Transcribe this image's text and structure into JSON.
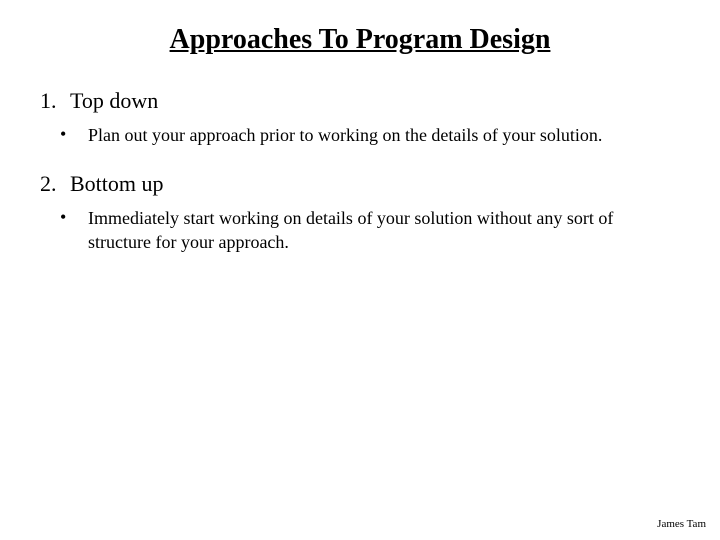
{
  "title": "Approaches To Program Design",
  "items": [
    {
      "number": "1.",
      "label": "Top down",
      "bullet_marker": "•",
      "bullet_text": "Plan out your approach prior to working on the details of your solution."
    },
    {
      "number": "2.",
      "label": "Bottom up",
      "bullet_marker": "•",
      "bullet_text": "Immediately start working on details of your solution without any sort of structure for your approach."
    }
  ],
  "footer": "James Tam"
}
